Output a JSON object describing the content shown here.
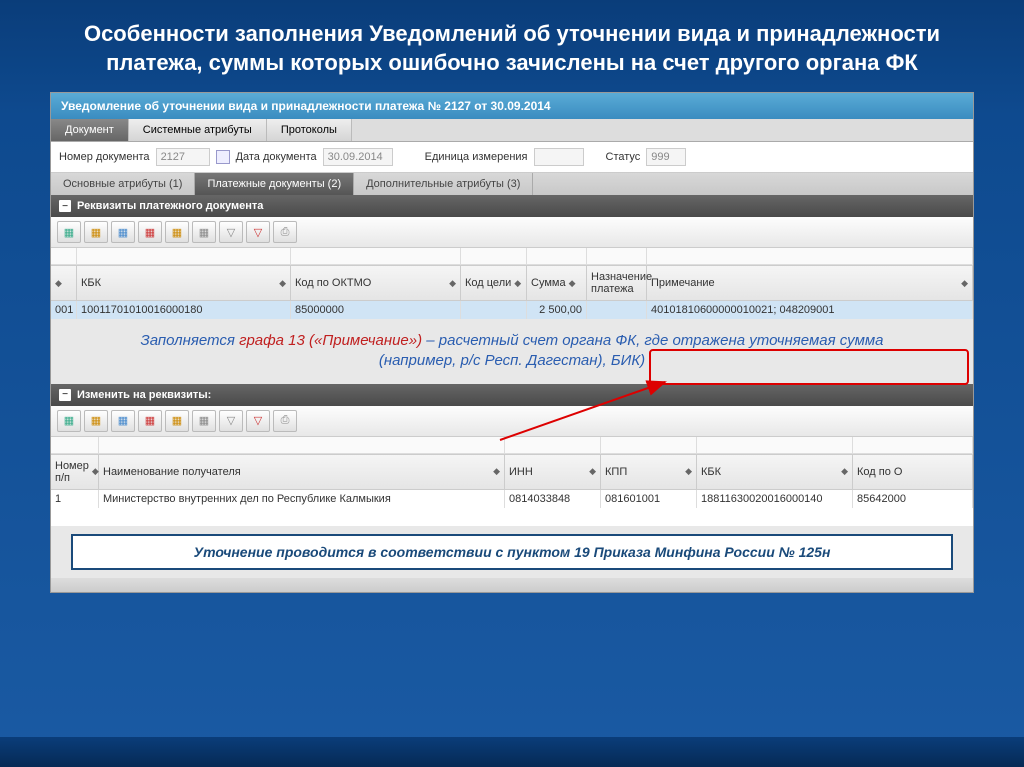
{
  "slide_title": "Особенности заполнения Уведомлений об уточнении вида и принадлежности платежа, суммы которых ошибочно зачислены на счет другого органа ФК",
  "window": {
    "title": "Уведомление об уточнении вида и принадлежности платежа № 2127 от 30.09.2014"
  },
  "main_tabs": [
    "Документ",
    "Системные атрибуты",
    "Протоколы"
  ],
  "main_tabs_active": 0,
  "form": {
    "doc_number_label": "Номер документа",
    "doc_number": "2127",
    "doc_date_label": "Дата документа",
    "doc_date": "30.09.2014",
    "unit_label": "Единица измерения",
    "unit": "",
    "status_label": "Статус",
    "status": "999"
  },
  "sub_tabs": [
    "Основные атрибуты (1)",
    "Платежные документы (2)",
    "Дополнительные атрибуты (3)"
  ],
  "sub_tabs_active": 1,
  "section1": {
    "title": "Реквизиты платежного документа",
    "headers": [
      "КБК",
      "Код по ОКТМО",
      "Код цели",
      "Сумма",
      "Назначение платежа",
      "Примечание"
    ],
    "row": {
      "num": "001",
      "kbk": "10011701010016000180",
      "oktmo": "85000000",
      "goal": "",
      "sum": "2 500,00",
      "purpose": "",
      "note": "40101810600000010021; 048209001"
    }
  },
  "annotation": {
    "prefix": "Заполняется ",
    "highlight": "графа 13 («Примечание»)",
    "rest": " – расчетный счет органа ФК, где отражена уточняемая сумма (например, р/с Респ. Дагестан), БИК)"
  },
  "section2": {
    "title": "Изменить на реквизиты:",
    "headers": [
      "Номер п/п",
      "Наименование получателя",
      "ИНН",
      "КПП",
      "КБК",
      "Код по О"
    ],
    "row": {
      "num": "1",
      "name": "Министерство внутренних дел по Республике Калмыкия",
      "inn": "0814033848",
      "kpp": "081601001",
      "kbk": "18811630020016000140",
      "oktmo": "85642000"
    }
  },
  "footer_note": "Уточнение проводится в соответствии с пунктом 19 Приказа Минфина России № 125н",
  "icons": {
    "grid_new": "▦",
    "funnel": "▼",
    "print": "⎙"
  }
}
